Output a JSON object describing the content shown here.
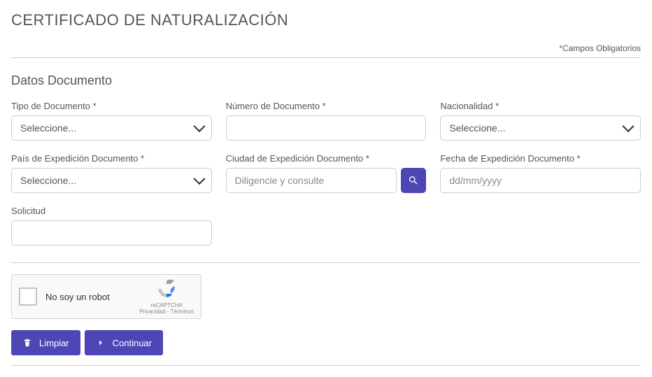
{
  "title": "CERTIFICADO DE NATURALIZACIÓN",
  "required_note": "*Campos Obligatorios",
  "section_title": "Datos Documento",
  "fields": {
    "tipo_doc": {
      "label": "Tipo de Documento *",
      "placeholder": "Seleccione..."
    },
    "numero_doc": {
      "label": "Número de Documento *"
    },
    "nacionalidad": {
      "label": "Nacionalidad *",
      "placeholder": "Seleccione..."
    },
    "pais_exp": {
      "label": "País de Expedición Documento *",
      "placeholder": "Seleccione..."
    },
    "ciudad_exp": {
      "label": "Ciudad de Expedición Documento *",
      "placeholder": "Diligencie y consulte"
    },
    "fecha_exp": {
      "label": "Fecha de Expedición Documento *",
      "placeholder": "dd/mm/yyyy"
    },
    "solicitud": {
      "label": "Solicitud"
    }
  },
  "recaptcha": {
    "label": "No soy un robot",
    "brand": "reCAPTCHA",
    "links": "Privacidad - Términos"
  },
  "buttons": {
    "limpiar": "Limpiar",
    "continuar": "Continuar"
  }
}
